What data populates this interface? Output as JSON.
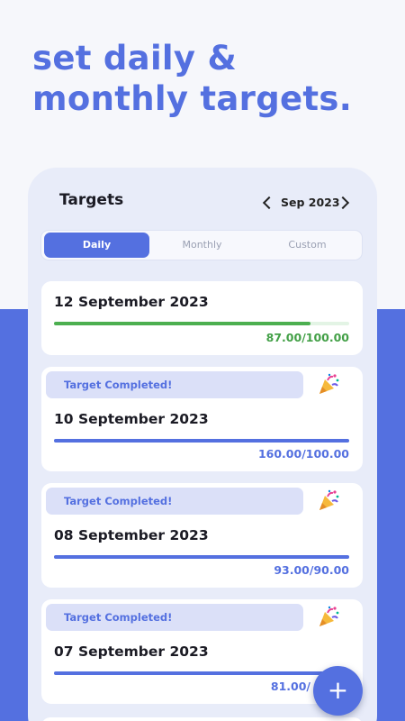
{
  "headline": {
    "line1": "set daily &",
    "line2": "monthly targets."
  },
  "colors": {
    "accent": "#5470e0",
    "progress_incomplete": "#4caf50",
    "value_incomplete": "#43a047",
    "banner_bg": "#dbe0f8"
  },
  "header": {
    "title": "Targets",
    "month": "Sep 2023",
    "prev_icon": "chevron-left-icon",
    "next_icon": "chevron-right-icon"
  },
  "tabs": [
    {
      "label": "Daily",
      "active": true
    },
    {
      "label": "Monthly",
      "active": false
    },
    {
      "label": "Custom",
      "active": false
    }
  ],
  "targets": [
    {
      "date": "12 September 2023",
      "progress": 0.87,
      "value": "87.00/100.00",
      "completed": false
    },
    {
      "date": "10 September 2023",
      "progress": 1.0,
      "value": "160.00/100.00",
      "completed": true,
      "banner": "Target Completed!"
    },
    {
      "date": "08 September 2023",
      "progress": 1.0,
      "value": "93.00/90.00",
      "completed": true,
      "banner": "Target Completed!"
    },
    {
      "date": "07 September 2023",
      "progress": 1.0,
      "value": "81.00/",
      "completed": true,
      "banner": "Target Completed!"
    }
  ],
  "fab": {
    "icon": "plus-icon",
    "label": "+"
  }
}
